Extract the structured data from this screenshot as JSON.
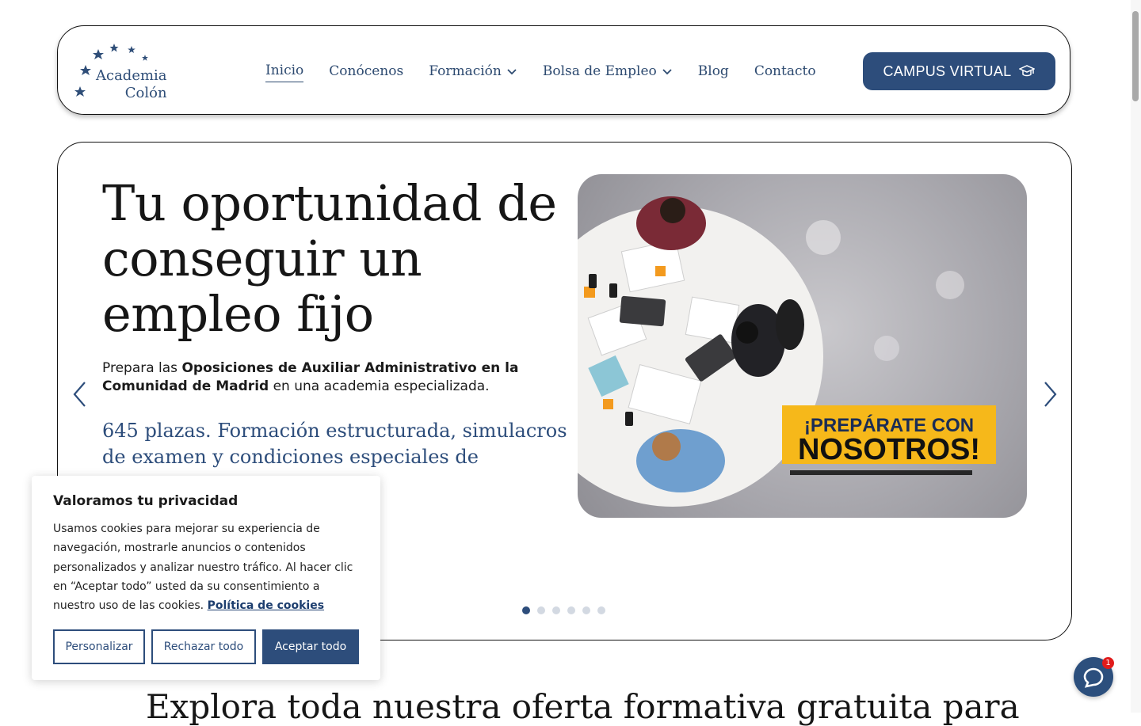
{
  "header": {
    "logo_line1": "Academia",
    "logo_line2": "Colón",
    "campus_button": "CAMPUS VIRTUAL"
  },
  "nav": {
    "items": [
      {
        "label": "Inicio",
        "active": true
      },
      {
        "label": "Conócenos"
      },
      {
        "label": "Formación",
        "has_dropdown": true
      },
      {
        "label": "Bolsa de Empleo",
        "has_dropdown": true
      },
      {
        "label": "Blog"
      },
      {
        "label": "Contacto"
      }
    ]
  },
  "hero": {
    "title": "Tu oportunidad de conseguir un empleo fijo",
    "desc_prefix": "Prepara las ",
    "desc_bold": "Oposiciones de Auxiliar Administrativo en la Comunidad de Madrid",
    "desc_suffix": " en una academia especializada.",
    "subtitle": "645 plazas. Formación estructurada, simulacros de examen y condiciones especiales de",
    "image_banner_line1": "¡PREPÁRATE CON",
    "image_banner_line2": "NOSOTROS!",
    "slide_count": 6,
    "active_slide": 1
  },
  "section": {
    "heading": "Explora toda nuestra oferta formativa gratuita para"
  },
  "cookie": {
    "title": "Valoramos tu privacidad",
    "text": "Usamos cookies para mejorar su experiencia de navegación, mostrarle anuncios o contenidos personalizados y analizar nuestro tráfico. Al hacer clic en “Aceptar todo” usted da su consentimiento a nuestro uso de las cookies. ",
    "link": "Política de cookies",
    "btn_customize": "Personalizar",
    "btn_reject": "Rechazar todo",
    "btn_accept": "Aceptar todo"
  },
  "chat": {
    "badge": "1"
  },
  "colors": {
    "brand": "#2d4d7b",
    "banner_yellow": "#f6b81a"
  }
}
